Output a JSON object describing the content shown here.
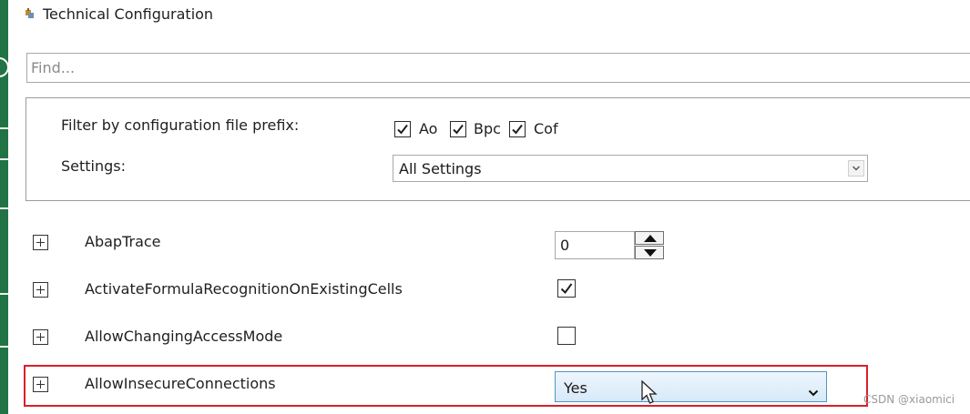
{
  "window": {
    "title": "Technical Configuration",
    "title_icon": "config-icon"
  },
  "search": {
    "placeholder": "Find...",
    "value": ""
  },
  "filter": {
    "prefix_label": "Filter by configuration file prefix:",
    "prefixes": [
      {
        "label": "Ao",
        "checked": true
      },
      {
        "label": "Bpc",
        "checked": true
      },
      {
        "label": "Cof",
        "checked": true
      }
    ],
    "settings_label": "Settings:",
    "settings_value": "All Settings"
  },
  "settings": [
    {
      "name": "AbapTrace",
      "control": "stepper",
      "value": "0"
    },
    {
      "name": "ActivateFormulaRecognitionOnExistingCells",
      "control": "checkbox",
      "checked": true
    },
    {
      "name": "AllowChangingAccessMode",
      "control": "checkbox",
      "checked": false
    },
    {
      "name": "AllowInsecureConnections",
      "control": "dropdown",
      "value": "Yes",
      "highlighted": true
    }
  ],
  "watermark": "CSDN @xiaomici",
  "colors": {
    "excel_green": "#217346",
    "highlight_red": "#d9202a",
    "dropdown_border": "#4f96c5"
  }
}
